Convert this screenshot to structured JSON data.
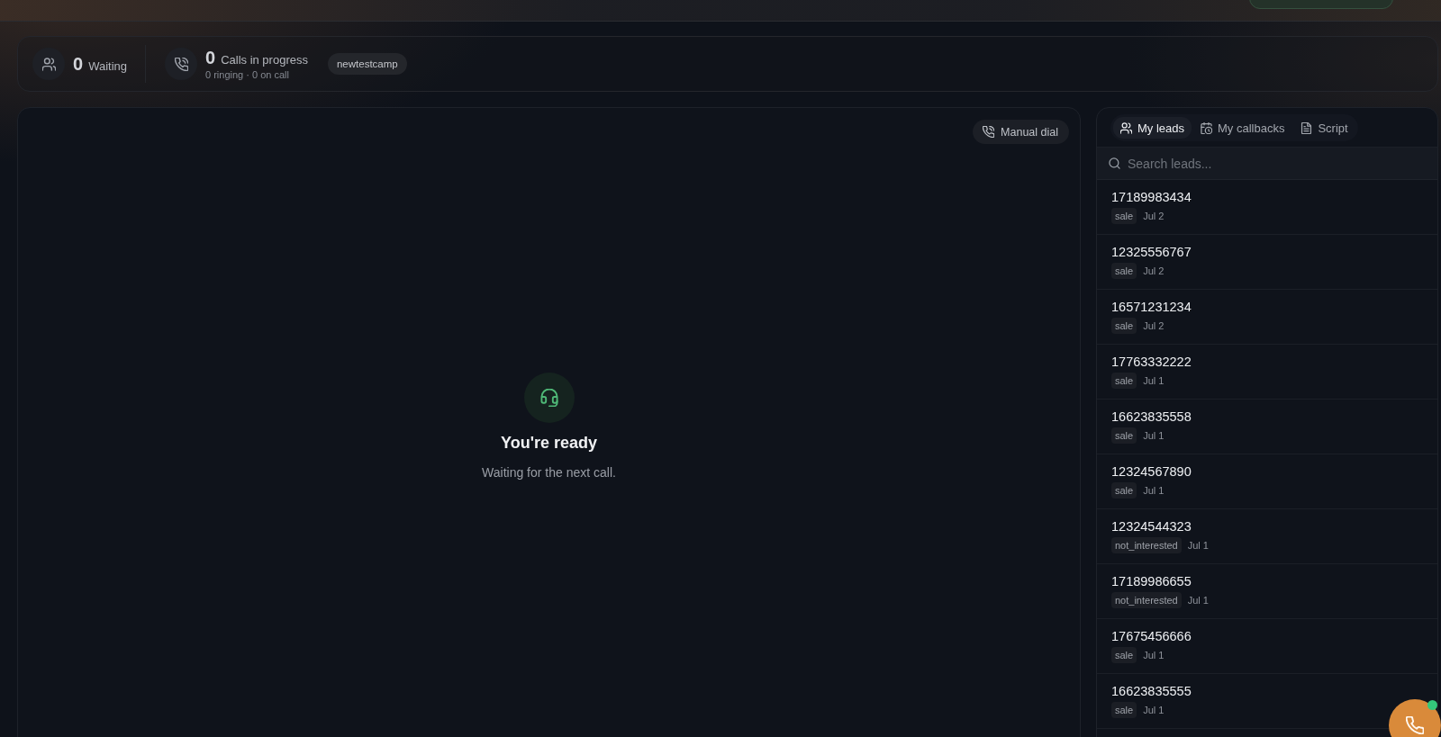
{
  "stats": [
    {
      "kind": "waiting",
      "count": "0",
      "label": "Waiting"
    },
    {
      "kind": "calls",
      "count": "0",
      "label": "Calls in progress",
      "detail": "0 ringing · 0 on call"
    }
  ],
  "campaign": "newtestcamp",
  "main": {
    "manual_dial": "Manual dial",
    "status_title": "You're ready",
    "status_text": "Waiting for the next call."
  },
  "side_panel": {
    "tabs": [
      {
        "kind": "leads",
        "label": "My leads",
        "selected": true
      },
      {
        "kind": "callbacks",
        "label": "My callbacks",
        "selected": false
      },
      {
        "kind": "script",
        "label": "Script",
        "selected": false
      }
    ],
    "search": {
      "placeholder": "Search leads..."
    },
    "leads": [
      {
        "phone": "17189983434",
        "disposition": "sale",
        "date": "Jul 2"
      },
      {
        "phone": "12325556767",
        "disposition": "sale",
        "date": "Jul 2"
      },
      {
        "phone": "16571231234",
        "disposition": "sale",
        "date": "Jul 2"
      },
      {
        "phone": "17763332222",
        "disposition": "sale",
        "date": "Jul 1"
      },
      {
        "phone": "16623835558",
        "disposition": "sale",
        "date": "Jul 1"
      },
      {
        "phone": "12324567890",
        "disposition": "sale",
        "date": "Jul 1"
      },
      {
        "phone": "12324544323",
        "disposition": "not_interested",
        "date": "Jul 1"
      },
      {
        "phone": "17189986655",
        "disposition": "not_interested",
        "date": "Jul 1"
      },
      {
        "phone": "17675456666",
        "disposition": "sale",
        "date": "Jul 1"
      },
      {
        "phone": "16623835555",
        "disposition": "sale",
        "date": "Jul 1"
      }
    ]
  },
  "dialer": {
    "online": true
  }
}
